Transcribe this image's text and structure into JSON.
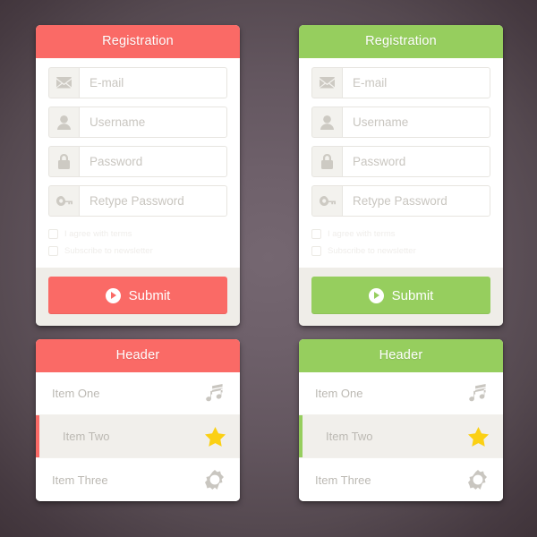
{
  "background": {
    "color_outer": "#3c3036",
    "color_center": "#756771"
  },
  "theme": {
    "red": "#fa6a66",
    "green": "#96ce5e",
    "star_yellow": "#fbd014",
    "panel_white": "#ffffff",
    "footer_gray": "#efede8",
    "active_row_gray": "#f1efeb",
    "placeholder_gray": "#c9c6c0"
  },
  "cards": {
    "registration_red": {
      "header": "Registration",
      "accent": "#fa6a66",
      "fields": [
        {
          "icon": "envelope-icon",
          "placeholder": "E-mail"
        },
        {
          "icon": "user-icon",
          "placeholder": "Username"
        },
        {
          "icon": "lock-icon",
          "placeholder": "Password"
        },
        {
          "icon": "key-icon",
          "placeholder": "Retype Password"
        }
      ],
      "checkboxes": [
        {
          "label": "I agree with terms",
          "checked": false
        },
        {
          "label": "Subscribe to newsletter",
          "checked": false
        }
      ],
      "submit": {
        "label": "Submit",
        "icon": "play-circle-icon"
      }
    },
    "registration_green": {
      "header": "Registration",
      "accent": "#96ce5e",
      "fields": [
        {
          "icon": "envelope-icon",
          "placeholder": "E-mail"
        },
        {
          "icon": "user-icon",
          "placeholder": "Username"
        },
        {
          "icon": "lock-icon",
          "placeholder": "Password"
        },
        {
          "icon": "key-icon",
          "placeholder": "Retype Password"
        }
      ],
      "checkboxes": [
        {
          "label": "I agree with terms",
          "checked": false
        },
        {
          "label": "Subscribe to newsletter",
          "checked": false
        }
      ],
      "submit": {
        "label": "Submit",
        "icon": "play-circle-icon"
      }
    },
    "list_red": {
      "header": "Header",
      "accent": "#fa6a66",
      "items": [
        {
          "label": "Item One",
          "icon": "music-note-icon",
          "active": false
        },
        {
          "label": "Item Two",
          "icon": "star-icon",
          "active": true
        },
        {
          "label": "Item Three",
          "icon": "sunburst-icon",
          "active": false
        }
      ]
    },
    "list_green": {
      "header": "Header",
      "accent": "#96ce5e",
      "items": [
        {
          "label": "Item One",
          "icon": "music-note-icon",
          "active": false
        },
        {
          "label": "Item Two",
          "icon": "star-icon",
          "active": true
        },
        {
          "label": "Item Three",
          "icon": "sunburst-icon",
          "active": false
        }
      ]
    }
  }
}
